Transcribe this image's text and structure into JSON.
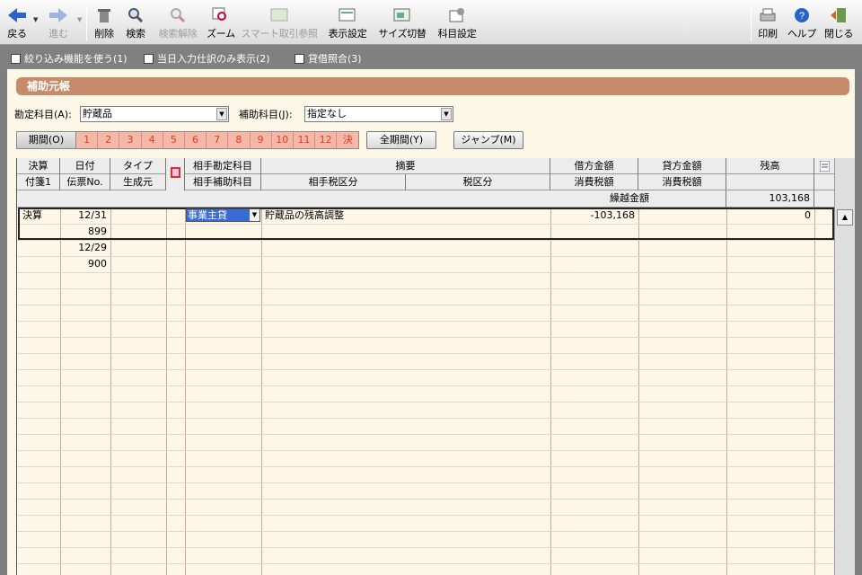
{
  "toolbar": {
    "back": "戻る",
    "forward": "進む",
    "delete": "削除",
    "search": "検索",
    "search_clear": "検索解除",
    "zoom": "ズーム",
    "smart_ref": "スマート取引参照",
    "display_settings": "表示設定",
    "size_switch": "サイズ切替",
    "account_settings": "科目設定",
    "print": "印刷",
    "help": "ヘルプ",
    "close": "閉じる"
  },
  "options": {
    "filter": "絞り込み機能を使う(1)",
    "today_only": "当日入力仕訳のみ表示(2)",
    "balance_check": "貸借照合(3)"
  },
  "panel": {
    "title": "補助元帳",
    "account_label": "勘定科目(A):",
    "account_value": "貯蔵品",
    "sub_account_label": "補助科目(J):",
    "sub_account_value": "指定なし",
    "period_label": "期間(O)",
    "months": [
      "1",
      "2",
      "3",
      "4",
      "5",
      "6",
      "7",
      "8",
      "9",
      "10",
      "11",
      "12",
      "決"
    ],
    "all_period_button": "全期間(Y)",
    "jump_button": "ジャンプ(M)"
  },
  "grid": {
    "headers_row1": {
      "settle": "決算",
      "date": "日付",
      "type": "タイプ",
      "counter_account": "相手勘定科目",
      "summary": "摘要",
      "debit": "借方金額",
      "credit": "貸方金額",
      "balance": "残高"
    },
    "headers_row2": {
      "memo": "付箋1",
      "voucher": "伝票No.",
      "origin": "生成元",
      "counter_sub": "相手補助科目",
      "counter_tax": "相手税区分",
      "tax": "税区分",
      "debit_tax": "消費税額",
      "credit_tax": "消費税額"
    },
    "carryover_label": "繰越金額",
    "carryover_value": "103,168",
    "rows": [
      {
        "settle": "決算",
        "date": "12/31",
        "voucher": "899",
        "counter_account": "事業主貸",
        "summary": "貯蔵品の残高調整",
        "debit": "-103,168",
        "balance": "0"
      },
      {
        "date": "12/29",
        "voucher": "900"
      }
    ]
  }
}
